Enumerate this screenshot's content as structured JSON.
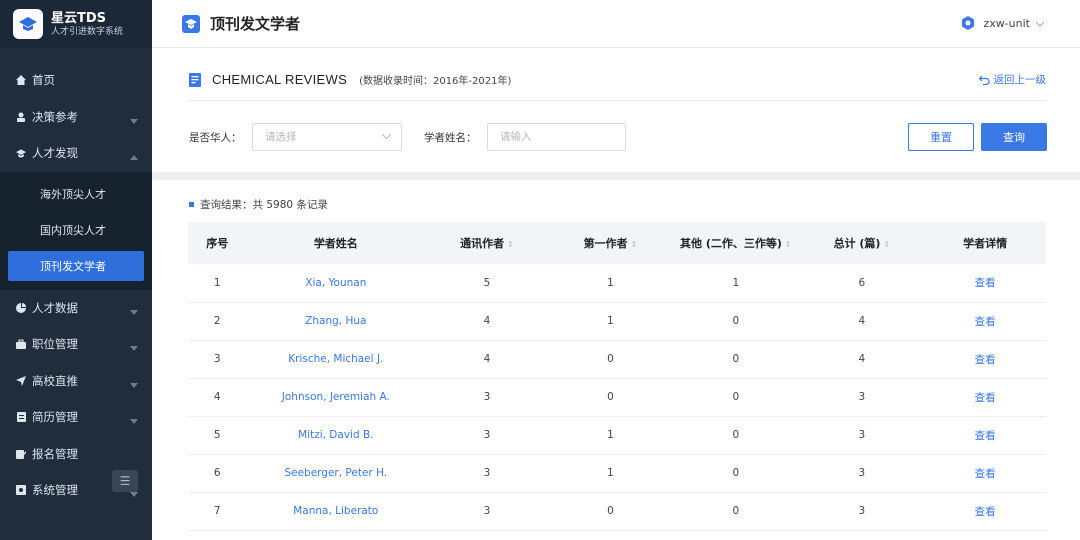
{
  "brand": {
    "title": "星云TDS",
    "subtitle": "人才引进数字系统"
  },
  "sidebar": {
    "items_top": [
      {
        "label": "首页",
        "icon": "home-icon",
        "expandable": false
      },
      {
        "label": "决策参考",
        "icon": "user-icon",
        "expandable": true
      },
      {
        "label": "人才发现",
        "icon": "graduation-cap-icon",
        "expandable": true,
        "expanded": true
      }
    ],
    "sub_items": [
      {
        "label": "海外顶尖人才",
        "active": false
      },
      {
        "label": "国内顶尖人才",
        "active": false
      },
      {
        "label": "顶刊发文学者",
        "active": true
      }
    ],
    "items_bottom": [
      {
        "label": "人才数据",
        "icon": "pie-chart-icon"
      },
      {
        "label": "职位管理",
        "icon": "briefcase-icon"
      },
      {
        "label": "高校直推",
        "icon": "send-icon"
      },
      {
        "label": "简历管理",
        "icon": "document-icon"
      },
      {
        "label": "报名管理",
        "icon": "signup-icon"
      },
      {
        "label": "系统管理",
        "icon": "settings-icon"
      }
    ],
    "collapse_glyph": "☰"
  },
  "header": {
    "title": "顶刊发文学者",
    "user": "zxw-unit"
  },
  "journal": {
    "name": "CHEMICAL REVIEWS",
    "range": "(数据收录时间：2016年-2021年)",
    "back": "返回上一级"
  },
  "filters": {
    "chinese_label": "是否华人：",
    "chinese_placeholder": "请选择",
    "name_label": "学者姓名：",
    "name_placeholder": "请输入",
    "reset": "重置",
    "query": "查询"
  },
  "results": {
    "summary": "查询结果：共 5980 条记录",
    "columns": [
      "序号",
      "学者姓名",
      "通讯作者",
      "第一作者",
      "其他 (二作、三作等)",
      "总计 (篇)",
      "学者详情"
    ],
    "rows": [
      {
        "no": "1",
        "name": "Xia, Younan",
        "corr": "5",
        "first": "1",
        "other": "1",
        "total": "6",
        "detail": "查看"
      },
      {
        "no": "2",
        "name": "Zhang, Hua",
        "corr": "4",
        "first": "1",
        "other": "0",
        "total": "4",
        "detail": "查看"
      },
      {
        "no": "3",
        "name": "Krische, Michael J.",
        "corr": "4",
        "first": "0",
        "other": "0",
        "total": "4",
        "detail": "查看"
      },
      {
        "no": "4",
        "name": "Johnson, Jeremiah A.",
        "corr": "3",
        "first": "0",
        "other": "0",
        "total": "3",
        "detail": "查看"
      },
      {
        "no": "5",
        "name": "Mitzi, David B.",
        "corr": "3",
        "first": "1",
        "other": "0",
        "total": "3",
        "detail": "查看"
      },
      {
        "no": "6",
        "name": "Seeberger, Peter H.",
        "corr": "3",
        "first": "1",
        "other": "0",
        "total": "3",
        "detail": "查看"
      },
      {
        "no": "7",
        "name": "Manna, Liberato",
        "corr": "3",
        "first": "0",
        "other": "0",
        "total": "3",
        "detail": "查看"
      }
    ]
  },
  "colors": {
    "accent": "#3a78e6",
    "sidebar": "#1f2d3d"
  }
}
